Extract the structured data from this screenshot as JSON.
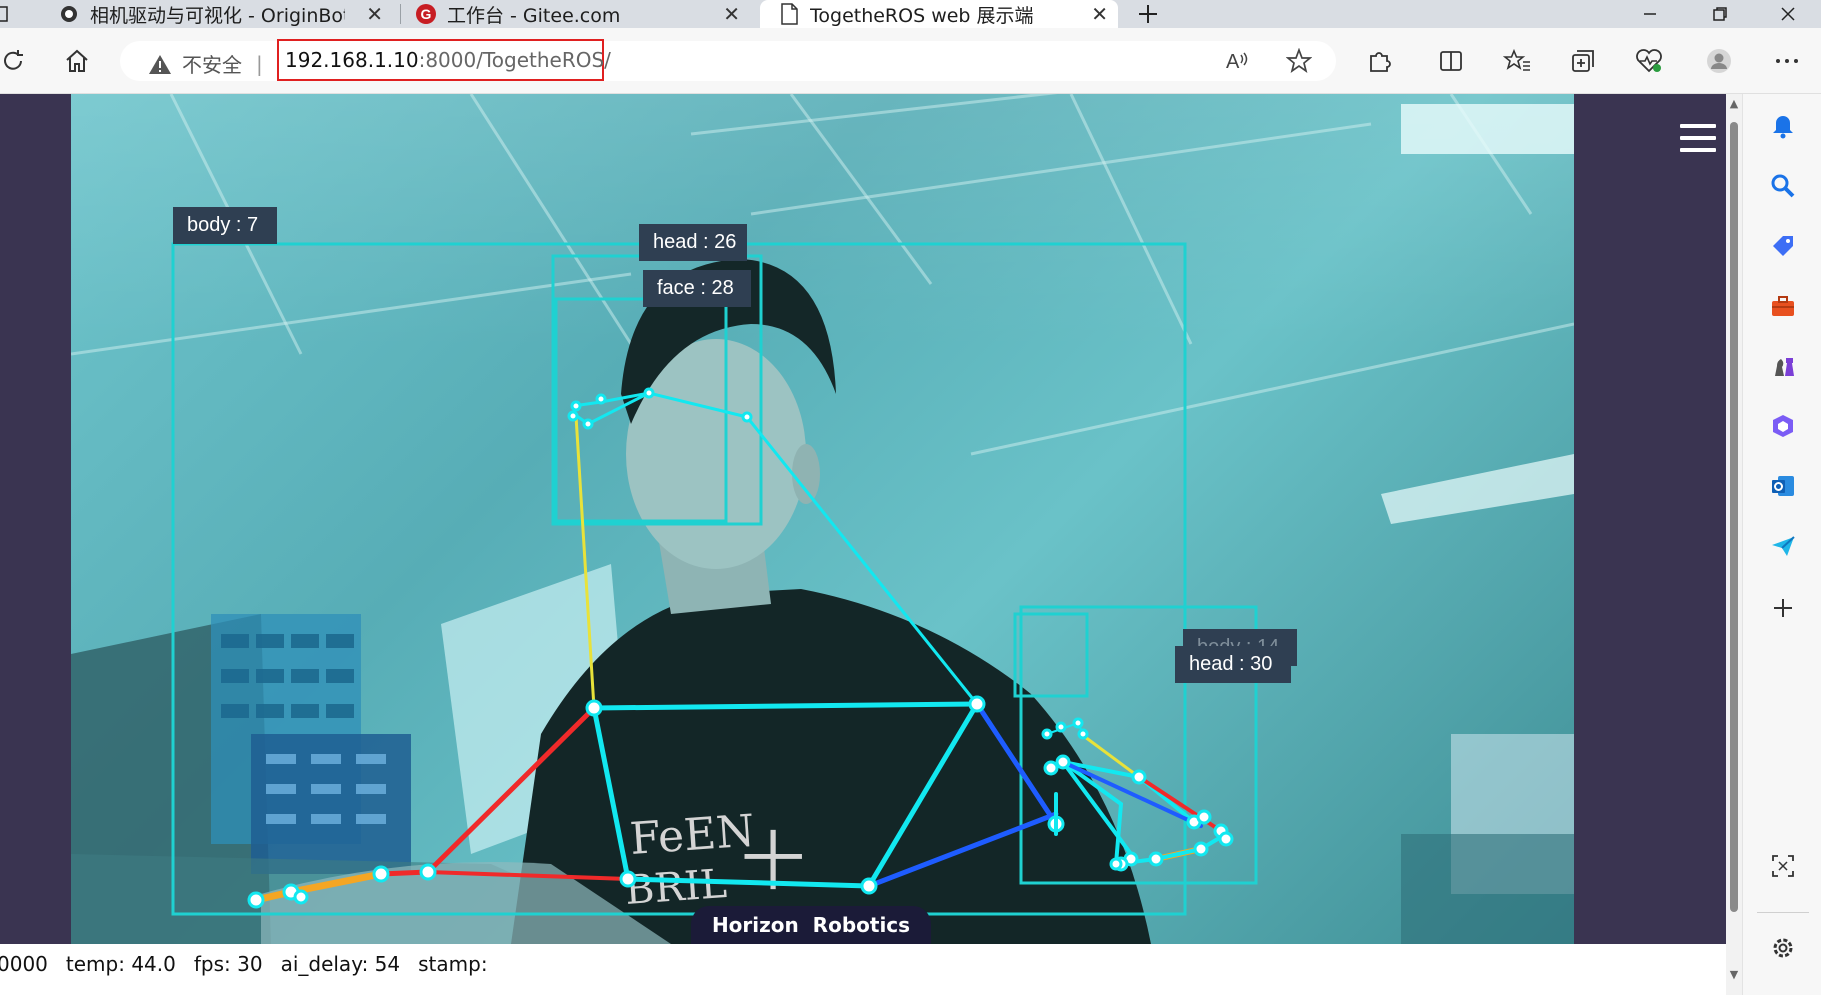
{
  "tabs": [
    {
      "title": "相机驱动与可视化 - OriginBot智能",
      "active": false
    },
    {
      "title": "工作台 - Gitee.com",
      "active": false
    },
    {
      "title": "TogetheROS web 展示端",
      "active": true
    }
  ],
  "address_bar": {
    "security_label": "不安全",
    "url_host": "192.168.1.10",
    "url_rest": ":8000/TogetheROS/"
  },
  "detections": [
    {
      "label": "body : 7"
    },
    {
      "label": "head : 26"
    },
    {
      "label": "face : 28"
    },
    {
      "label": "body : 14"
    },
    {
      "label": "head : 30"
    }
  ],
  "watermark": "Horizon  Robotics",
  "status": {
    "frame": "0000",
    "temp": "temp: 44.0",
    "fps": "fps: 30",
    "ai_delay": "ai_delay: 54",
    "stamp": "stamp:"
  },
  "colors": {
    "box": "#1fd1d1",
    "skeleton_cyan": "#12e8f0",
    "limb_red": "#f02a2a",
    "limb_orange": "#f5a623",
    "limb_blue": "#1e5cff",
    "limb_yellow": "#e8e23a",
    "label_bg": "#2f3f52",
    "page_bg": "#3a3451",
    "url_highlight": "#e02020"
  },
  "icons": {
    "tab1": "originbot-favicon",
    "tab2": "gitee-favicon",
    "tab3": "page-icon",
    "sidebar": [
      "bell-icon",
      "search-icon",
      "tag-icon",
      "toolbox-icon",
      "chess-icon",
      "office-icon",
      "outlook-icon",
      "send-icon",
      "plus-icon",
      "screenshot-icon",
      "gear-icon"
    ]
  }
}
